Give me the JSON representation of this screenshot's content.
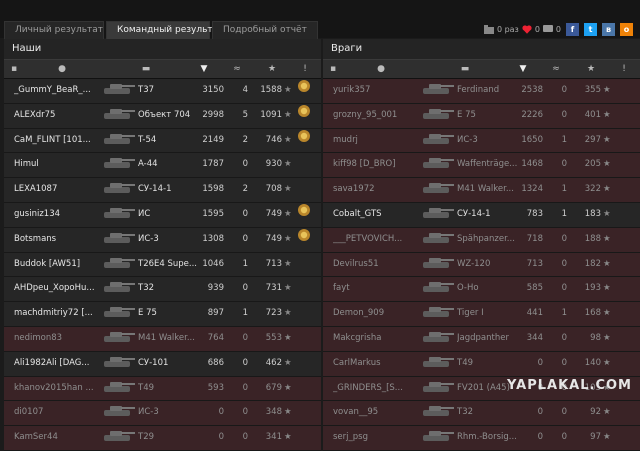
{
  "tabs": [
    "Личный результат",
    "Командный результат",
    "Подробный отчёт"
  ],
  "top": {
    "views": "0 раз",
    "likes": "0",
    "comments": "0"
  },
  "panels": {
    "left": {
      "title": "Наши",
      "rows": [
        {
          "player": "_GummY_BeaR_...",
          "vehicle": "T37",
          "dmg": "3150",
          "kills": "4",
          "xp": "1588",
          "dead": false,
          "medal": true
        },
        {
          "player": "ALEXdr75",
          "vehicle": "Объект 704",
          "dmg": "2998",
          "kills": "5",
          "xp": "1091",
          "dead": false,
          "medal": true
        },
        {
          "player": "CaM_FLINT [101...",
          "vehicle": "T-54",
          "dmg": "2149",
          "kills": "2",
          "xp": "746",
          "dead": false,
          "medal": true
        },
        {
          "player": "Himul",
          "vehicle": "A-44",
          "dmg": "1787",
          "kills": "0",
          "xp": "930",
          "dead": false,
          "medal": false
        },
        {
          "player": "LEXA1087",
          "vehicle": "СУ-14-1",
          "dmg": "1598",
          "kills": "2",
          "xp": "708",
          "dead": false,
          "medal": false
        },
        {
          "player": "gusiniz134",
          "vehicle": "ИС",
          "dmg": "1595",
          "kills": "0",
          "xp": "749",
          "dead": false,
          "medal": true
        },
        {
          "player": "Botsmans",
          "vehicle": "ИС-3",
          "dmg": "1308",
          "kills": "0",
          "xp": "749",
          "dead": false,
          "medal": true
        },
        {
          "player": "Buddok [AW51]",
          "vehicle": "T26E4 Supe...",
          "dmg": "1046",
          "kills": "1",
          "xp": "713",
          "dead": false,
          "medal": false
        },
        {
          "player": "AHDpeu_XopoHu...",
          "vehicle": "T32",
          "dmg": "939",
          "kills": "0",
          "xp": "731",
          "dead": false,
          "medal": false
        },
        {
          "player": "machdmitriy72 [...",
          "vehicle": "E 75",
          "dmg": "897",
          "kills": "1",
          "xp": "723",
          "dead": false,
          "medal": false
        },
        {
          "player": "nedimon83",
          "vehicle": "M41 Walker...",
          "dmg": "764",
          "kills": "0",
          "xp": "553",
          "dead": true,
          "medal": false
        },
        {
          "player": "Ali1982Ali [DAG...",
          "vehicle": "СУ-101",
          "dmg": "686",
          "kills": "0",
          "xp": "462",
          "dead": false,
          "medal": false
        },
        {
          "player": "khanov2015han ...",
          "vehicle": "T49",
          "dmg": "593",
          "kills": "0",
          "xp": "679",
          "dead": true,
          "medal": false
        },
        {
          "player": "di0107",
          "vehicle": "ИС-3",
          "dmg": "0",
          "kills": "0",
          "xp": "348",
          "dead": true,
          "medal": false
        },
        {
          "player": "KamSer44",
          "vehicle": "T29",
          "dmg": "0",
          "kills": "0",
          "xp": "341",
          "dead": true,
          "medal": false
        }
      ]
    },
    "right": {
      "title": "Враги",
      "rows": [
        {
          "player": "yurik357",
          "vehicle": "Ferdinand",
          "dmg": "2538",
          "kills": "0",
          "xp": "355",
          "dead": true,
          "medal": false
        },
        {
          "player": "grozny_95_001",
          "vehicle": "E 75",
          "dmg": "2226",
          "kills": "0",
          "xp": "401",
          "dead": true,
          "medal": false
        },
        {
          "player": "mudrj",
          "vehicle": "ИС-3",
          "dmg": "1650",
          "kills": "1",
          "xp": "297",
          "dead": true,
          "medal": false
        },
        {
          "player": "kiff98 [D_BRO]",
          "vehicle": "Waffenträge...",
          "dmg": "1468",
          "kills": "0",
          "xp": "205",
          "dead": true,
          "medal": false
        },
        {
          "player": "sava1972",
          "vehicle": "M41 Walker...",
          "dmg": "1324",
          "kills": "1",
          "xp": "322",
          "dead": true,
          "medal": false
        },
        {
          "player": "Cobalt_GTS",
          "vehicle": "СУ-14-1",
          "dmg": "783",
          "kills": "1",
          "xp": "183",
          "dead": false,
          "medal": false
        },
        {
          "player": "___PETVOVICH...",
          "vehicle": "Spähpanzer...",
          "dmg": "718",
          "kills": "0",
          "xp": "188",
          "dead": true,
          "medal": false
        },
        {
          "player": "Devilrus51",
          "vehicle": "WZ-120",
          "dmg": "713",
          "kills": "0",
          "xp": "182",
          "dead": true,
          "medal": false
        },
        {
          "player": "fayt",
          "vehicle": "O-Ho",
          "dmg": "585",
          "kills": "0",
          "xp": "193",
          "dead": true,
          "medal": false
        },
        {
          "player": "Demon_909",
          "vehicle": "Tiger I",
          "dmg": "441",
          "kills": "1",
          "xp": "168",
          "dead": true,
          "medal": false
        },
        {
          "player": "Makcgrisha",
          "vehicle": "Jagdpanther",
          "dmg": "344",
          "kills": "0",
          "xp": "98",
          "dead": true,
          "medal": false
        },
        {
          "player": "CarlMarkus",
          "vehicle": "T49",
          "dmg": "0",
          "kills": "0",
          "xp": "140",
          "dead": true,
          "medal": false
        },
        {
          "player": "_GRINDERS_[S...",
          "vehicle": "FV201 (A45)",
          "dmg": "0",
          "kills": "0",
          "xp": "105",
          "dead": true,
          "medal": false
        },
        {
          "player": "vovan__95",
          "vehicle": "T32",
          "dmg": "0",
          "kills": "0",
          "xp": "92",
          "dead": true,
          "medal": false
        },
        {
          "player": "serj_psg",
          "vehicle": "Rhm.-Borsig...",
          "dmg": "0",
          "kills": "0",
          "xp": "97",
          "dead": true,
          "medal": false
        }
      ]
    }
  },
  "watermark": "YAPLAKAL.COM"
}
